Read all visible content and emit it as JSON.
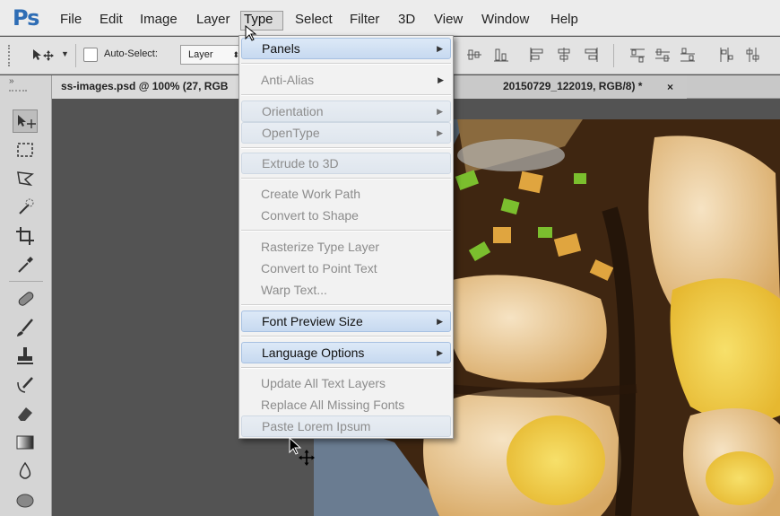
{
  "app": {
    "logo": "Ps"
  },
  "menubar": {
    "items": [
      {
        "label": "File"
      },
      {
        "label": "Edit"
      },
      {
        "label": "Image"
      },
      {
        "label": "Layer"
      },
      {
        "label": "Type",
        "active": true
      },
      {
        "label": "Select"
      },
      {
        "label": "Filter"
      },
      {
        "label": "3D"
      },
      {
        "label": "View"
      },
      {
        "label": "Window"
      },
      {
        "label": "Help"
      }
    ]
  },
  "options_bar": {
    "auto_select_label": "Auto-Select:",
    "auto_select_checked": false,
    "auto_select_target": "Layer"
  },
  "documents": {
    "tabs": [
      {
        "label": "ss-images.psd @ 100% (27, RGB"
      },
      {
        "label": "20150729_122019, RGB/8) *",
        "close": "×"
      }
    ]
  },
  "type_menu": {
    "items": [
      {
        "label": "Panels",
        "submenu": true,
        "enabled": true,
        "highlight": "active"
      },
      {
        "label": "Anti-Alias",
        "submenu": true,
        "enabled": false
      },
      {
        "label": "Orientation",
        "submenu": true,
        "enabled": false,
        "highlight": "muted"
      },
      {
        "label": "OpenType",
        "submenu": true,
        "enabled": false,
        "highlight": "muted"
      },
      {
        "label": "Extrude to 3D",
        "submenu": false,
        "enabled": false,
        "highlight": "muted"
      },
      {
        "label": "Create Work Path",
        "submenu": false,
        "enabled": false
      },
      {
        "label": "Convert to Shape",
        "submenu": false,
        "enabled": false
      },
      {
        "label": "Rasterize Type Layer",
        "submenu": false,
        "enabled": false
      },
      {
        "label": "Convert to Point Text",
        "submenu": false,
        "enabled": false
      },
      {
        "label": "Warp Text...",
        "submenu": false,
        "enabled": false
      },
      {
        "label": "Font Preview Size",
        "submenu": true,
        "enabled": true,
        "highlight": "active"
      },
      {
        "label": "Language Options",
        "submenu": true,
        "enabled": true,
        "highlight": "active"
      },
      {
        "label": "Update All Text Layers",
        "submenu": false,
        "enabled": false
      },
      {
        "label": "Replace All Missing Fonts",
        "submenu": false,
        "enabled": false
      },
      {
        "label": "Paste Lorem Ipsum",
        "submenu": false,
        "enabled": false,
        "highlight": "muted"
      }
    ]
  },
  "icons": {
    "toolbar": [
      "move-icon",
      "marquee-icon",
      "lasso-icon",
      "magic-wand-icon",
      "crop-icon",
      "eyedropper-icon",
      "healing-brush-icon",
      "brush-icon",
      "clone-stamp-icon",
      "history-brush-icon",
      "eraser-icon",
      "gradient-icon",
      "blur-icon",
      "sponge-icon"
    ]
  },
  "colors": {
    "accent": "#2e6db5",
    "menu_highlight": "#c7d9f0",
    "disabled_text": "#8c8c8c"
  }
}
